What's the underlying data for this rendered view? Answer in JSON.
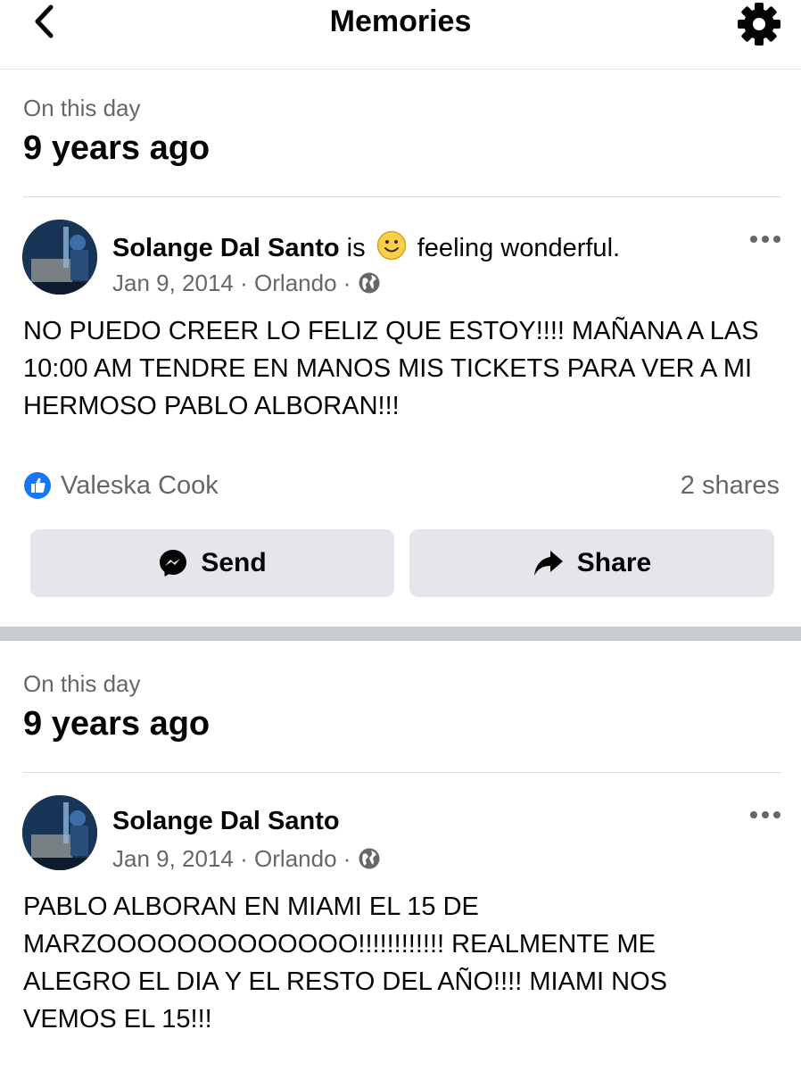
{
  "header": {
    "title": "Memories",
    "back_icon": "chevron-left-icon",
    "settings_icon": "gear-icon"
  },
  "memories": [
    {
      "on_this_day": "On this day",
      "years_ago": "9 years ago",
      "post": {
        "author": "Solange Dal Santo",
        "is_text": "is",
        "feeling_text": "feeling wonderful.",
        "date": "Jan 9, 2014",
        "location": "Orlando",
        "separator": "·",
        "text": "NO PUEDO CREER LO FELIZ QUE ESTOY!!!! MAÑANA A LAS 10:00 AM TENDRE EN MANOS MIS TICKETS PARA VER A MI HERMOSO PABLO ALBORAN!!!",
        "reactor": "Valeska Cook",
        "shares": "2 shares",
        "send_label": "Send",
        "share_label": "Share"
      }
    },
    {
      "on_this_day": "On this day",
      "years_ago": "9 years ago",
      "post": {
        "author": "Solange Dal Santo",
        "date": "Jan 9, 2014",
        "location": "Orlando",
        "separator": "·",
        "text": "PABLO ALBORAN EN MIAMI EL 15 DE MARZOOOOOOOOOOOOO!!!!!!!!!!!! REALMENTE ME ALEGRO EL DIA Y EL RESTO DEL AÑO!!!! MIAMI NOS VEMOS EL 15!!!"
      }
    }
  ],
  "colors": {
    "secondary_text": "#65676b",
    "button_bg": "#e4e6eb",
    "like_blue": "#1877f2",
    "section_separator": "#c9ccd1"
  }
}
